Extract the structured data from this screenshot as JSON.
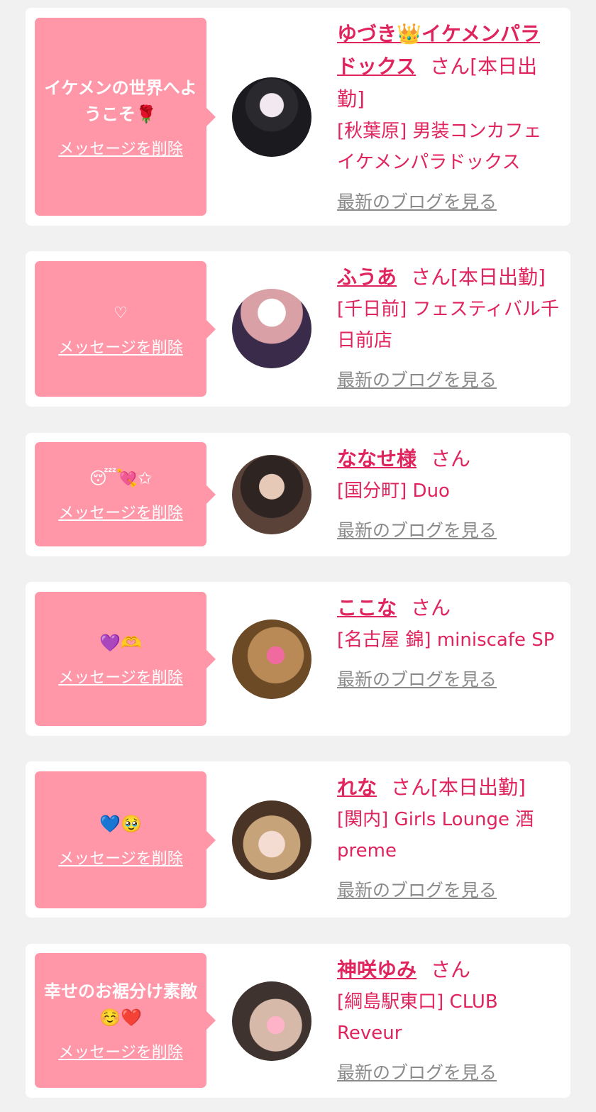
{
  "delete_label": "メッセージを削除",
  "blog_label": "最新のブログを見る",
  "cards": [
    {
      "message": "イケメンの世界へようこそ🌹",
      "name": "ゆづき👑イケメンパラドックス",
      "suffix": "さん",
      "status": "[本日出勤]",
      "area": "[秋葉原] 男装コンカフェイケメンパラドックス"
    },
    {
      "message": "♡",
      "name": "ふうあ",
      "suffix": "さん",
      "status": "[本日出勤]",
      "area": "[千日前] フェスティバル千日前店"
    },
    {
      "message": "😴💘✩",
      "name": "ななせ様",
      "suffix": "さん",
      "status": "",
      "area": "[国分町] Duo"
    },
    {
      "message": "💜🫶",
      "name": "ここな",
      "suffix": "さん",
      "status": "",
      "area": "[名古屋 錦] miniscafe SP"
    },
    {
      "message": "💙🥹",
      "name": "れな",
      "suffix": "さん",
      "status": "[本日出勤]",
      "area": "[関内] Girls Lounge 酒preme"
    },
    {
      "message": "幸せのお裾分け素敵☺️❤️",
      "name": "神咲ゆみ",
      "suffix": "さん",
      "status": "",
      "area": "[綱島駅東口] CLUB Reveur"
    }
  ],
  "colors": {
    "accent": "#e0245e",
    "bubble": "#ff97a9",
    "background": "#f1f1f1",
    "link_gray": "#8a8a8a"
  }
}
